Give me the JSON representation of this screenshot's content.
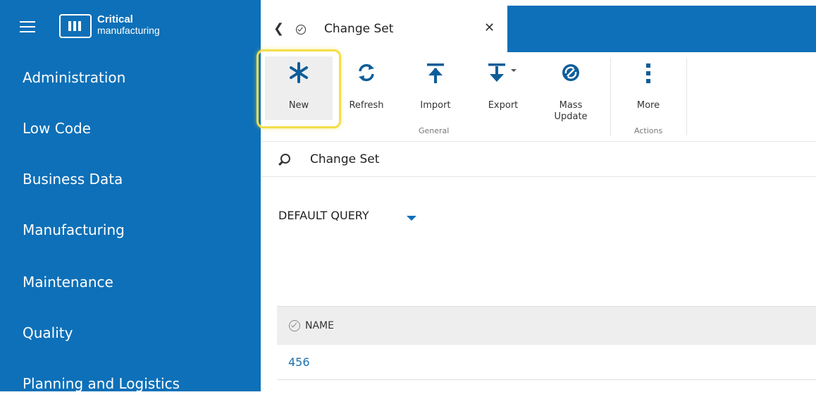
{
  "app": {
    "logo_line1": "Critical",
    "logo_line2": "manufacturing",
    "brand_color": "#0e70b8",
    "highlight_color": "#f3de4a"
  },
  "sidebar": {
    "items": [
      {
        "label": "Administration"
      },
      {
        "label": "Low Code"
      },
      {
        "label": "Business Data"
      },
      {
        "label": "Manufacturing"
      },
      {
        "label": "Maintenance"
      },
      {
        "label": "Quality"
      },
      {
        "label": "Planning and Logistics"
      }
    ]
  },
  "tab": {
    "title": "Change Set",
    "back_icon": "chevron-left-icon",
    "status_icon": "check-circle-icon",
    "close_icon": "close-icon"
  },
  "ribbon": {
    "buttons": [
      {
        "label": "New",
        "icon": "asterisk-icon"
      },
      {
        "label": "Refresh",
        "icon": "refresh-icon"
      },
      {
        "label": "Import",
        "icon": "import-icon"
      },
      {
        "label": "Export",
        "icon": "export-icon"
      },
      {
        "label_line1": "Mass",
        "label_line2": "Update",
        "icon": "mass-update-icon"
      },
      {
        "label": "More",
        "icon": "more-vertical-icon"
      }
    ],
    "groups": {
      "general": "General",
      "actions": "Actions"
    }
  },
  "search": {
    "label": "Change Set",
    "icon": "search-icon"
  },
  "query": {
    "label": "DEFAULT QUERY"
  },
  "grid": {
    "columns": [
      "NAME"
    ],
    "rows": [
      [
        "456"
      ]
    ]
  }
}
